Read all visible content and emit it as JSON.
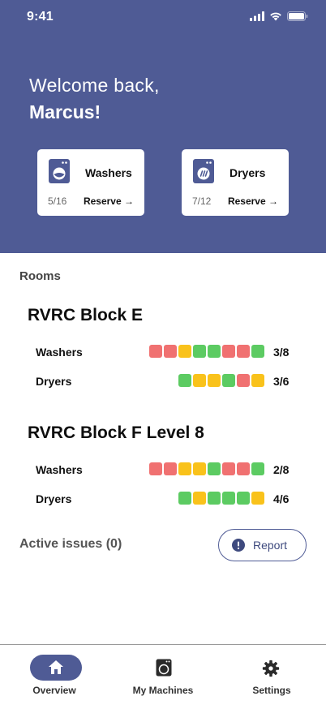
{
  "status_bar": {
    "time": "9:41"
  },
  "welcome": {
    "line1": "Welcome back,",
    "name": "Marcus!"
  },
  "summary_cards": [
    {
      "title": "Washers",
      "count": "5/16",
      "reserve": "Reserve →",
      "icon": "washer-icon"
    },
    {
      "title": "Dryers",
      "count": "7/12",
      "reserve": "Reserve →",
      "icon": "dryer-icon"
    }
  ],
  "rooms_label": "Rooms",
  "rooms": [
    {
      "name": "RVRC Block E",
      "rows": [
        {
          "label": "Washers",
          "count": "3/8",
          "statuses": [
            "red",
            "red",
            "yellow",
            "green",
            "green",
            "red",
            "red",
            "green"
          ]
        },
        {
          "label": "Dryers",
          "count": "3/6",
          "statuses": [
            "green",
            "yellow",
            "yellow",
            "green",
            "red",
            "yellow"
          ]
        }
      ]
    },
    {
      "name": "RVRC Block F Level 8",
      "rows": [
        {
          "label": "Washers",
          "count": "2/8",
          "statuses": [
            "red",
            "red",
            "yellow",
            "yellow",
            "green",
            "red",
            "red",
            "green"
          ]
        },
        {
          "label": "Dryers",
          "count": "4/6",
          "statuses": [
            "green",
            "yellow",
            "green",
            "green",
            "green",
            "yellow"
          ]
        }
      ]
    }
  ],
  "issues": {
    "label": "Active issues (0)",
    "report_label": "Report"
  },
  "nav": {
    "items": [
      {
        "label": "Overview",
        "icon": "home-icon",
        "active": true
      },
      {
        "label": "My Machines",
        "icon": "washer-icon",
        "active": false
      },
      {
        "label": "Settings",
        "icon": "gear-icon",
        "active": false
      }
    ]
  },
  "colors": {
    "brand": "#4f5b95",
    "red": "#f07171",
    "yellow": "#f9c21b",
    "green": "#5ccb62"
  }
}
